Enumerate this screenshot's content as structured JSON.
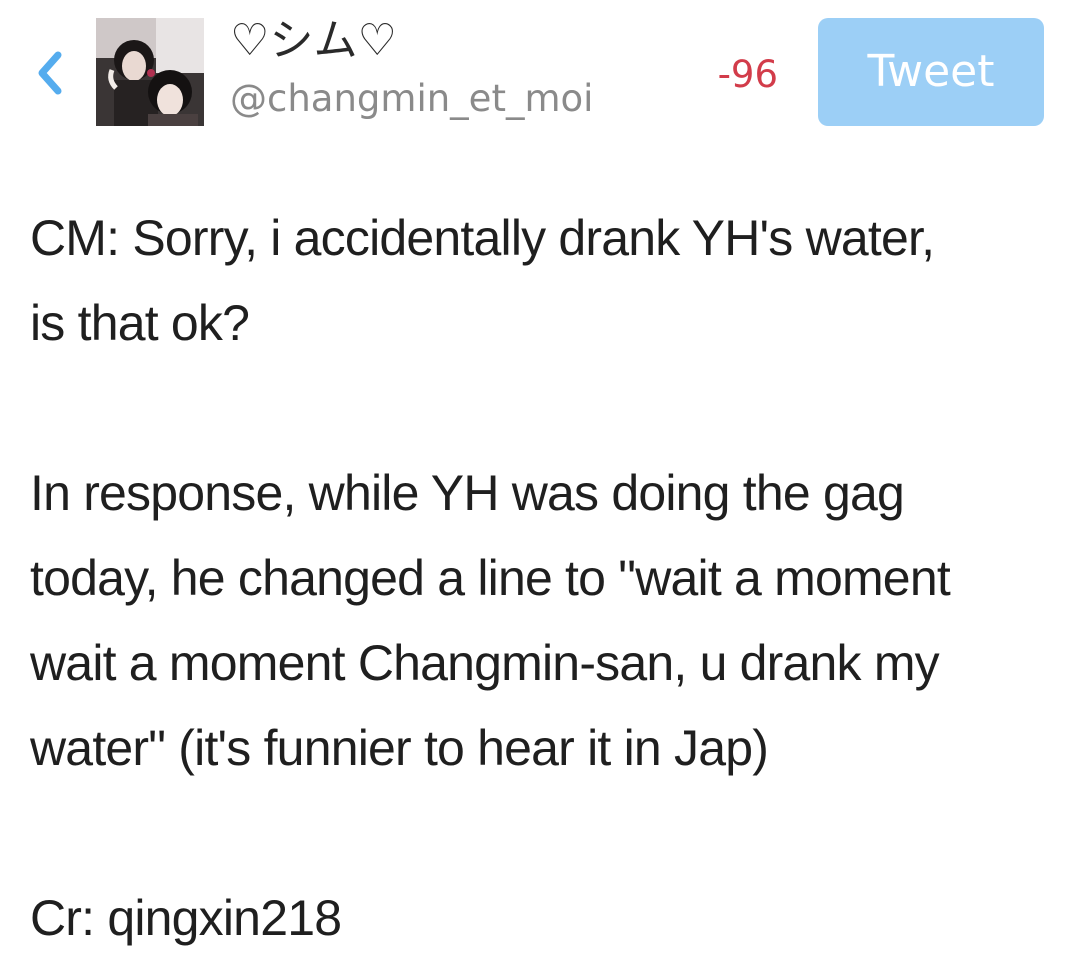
{
  "header": {
    "back_icon": "chevron-left-icon",
    "display_name": "♡シム♡",
    "handle": "@changmin_et_moi",
    "char_count": "-96",
    "tweet_label": "Tweet"
  },
  "colors": {
    "accent": "#55acee",
    "tweet_button_disabled": "#9ccff6",
    "char_count_negative": "#d23c4a",
    "handle_gray": "#8a8a8a"
  },
  "tweet": {
    "lines": [
      "CM: Sorry, i accidentally drank YH's water,",
      "is that ok?",
      "In response, while YH was doing the gag",
      "today, he changed a line to \"wait a moment",
      "wait a moment Changmin-san, u drank my",
      "water\" (it's funnier to hear it in Jap)",
      "Cr: qingxin218"
    ]
  }
}
